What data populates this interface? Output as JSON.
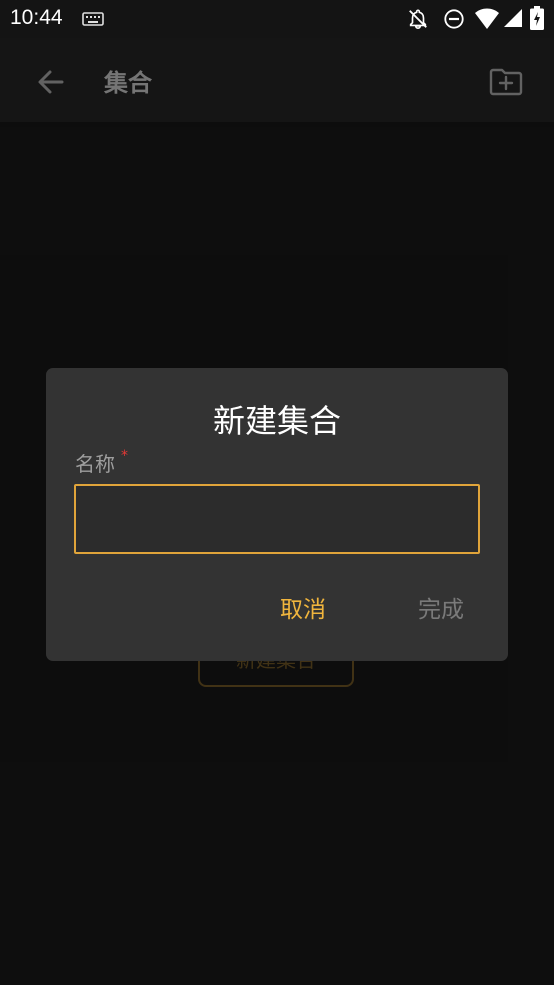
{
  "status_bar": {
    "time": "10:44",
    "icons": [
      "keyboard-icon",
      "bell-off-icon",
      "do-not-disturb-icon",
      "wifi-icon",
      "signal-icon",
      "battery-icon"
    ]
  },
  "app_bar": {
    "title": "集合",
    "back_icon": "arrow-back-icon",
    "action_icon": "folder-add-icon"
  },
  "background": {
    "create_button_label": "新建集合"
  },
  "dialog": {
    "title": "新建集合",
    "field_label": "名称",
    "required_mark": "*",
    "input_value": "",
    "cancel_label": "取消",
    "done_label": "完成"
  },
  "colors": {
    "accent": "#f0b53d",
    "input_border": "#e0a43a",
    "required": "#e53935",
    "dialog_bg": "#333333",
    "page_bg": "#161616"
  }
}
